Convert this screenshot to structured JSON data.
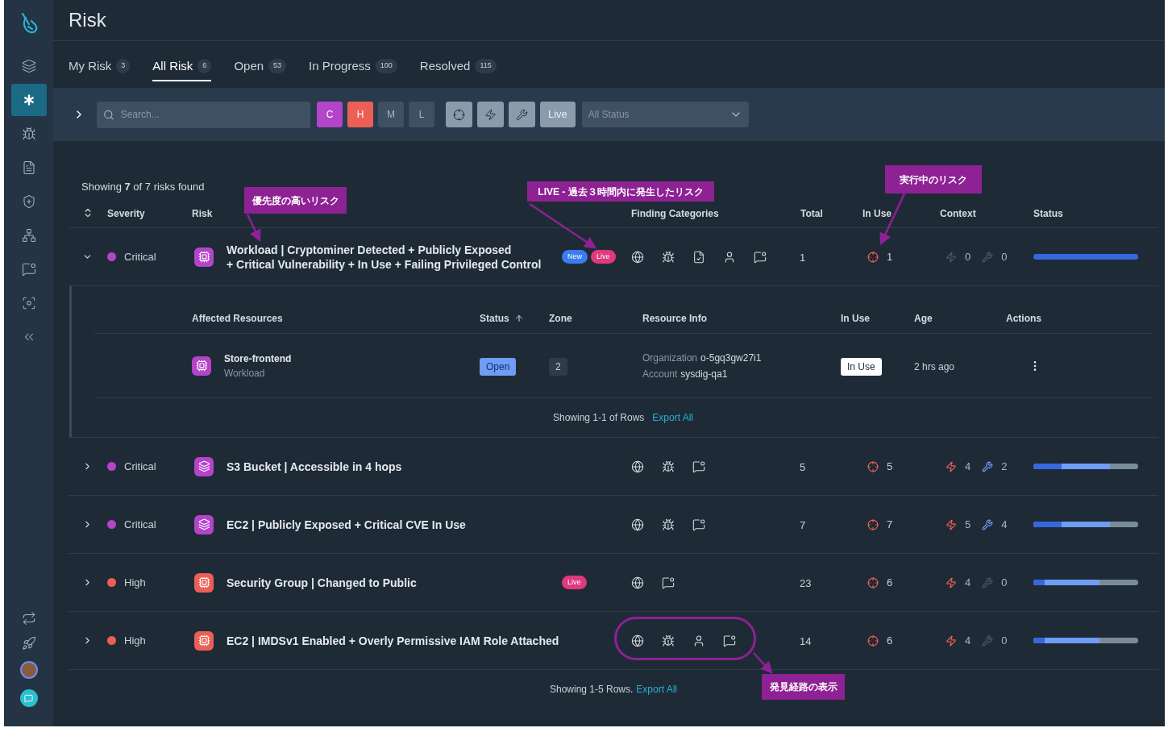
{
  "sidebar": {
    "items": [
      {
        "kind": "layers",
        "selected": false
      },
      {
        "kind": "asterisk",
        "selected": true
      },
      {
        "kind": "bug",
        "selected": false
      },
      {
        "kind": "report",
        "selected": false
      },
      {
        "kind": "shield",
        "selected": false
      },
      {
        "kind": "network",
        "selected": false
      },
      {
        "kind": "message",
        "selected": false
      },
      {
        "kind": "scan",
        "selected": false
      },
      {
        "kind": "collapse",
        "selected": false
      }
    ],
    "bottom_items": [
      {
        "kind": "repeat"
      },
      {
        "kind": "rocket"
      },
      {
        "kind": "avatar"
      },
      {
        "kind": "chat"
      }
    ]
  },
  "page_title": "Risk",
  "tabs": [
    {
      "label": "My Risk",
      "count": "3",
      "selected": false
    },
    {
      "label": "All Risk",
      "count": "6",
      "selected": true
    },
    {
      "label": "Open",
      "count": "53",
      "selected": false
    },
    {
      "label": "In Progress",
      "count": "100",
      "selected": false
    },
    {
      "label": "Resolved",
      "count": "115",
      "selected": false
    }
  ],
  "filters": {
    "search_placeholder": "Search...",
    "severity": [
      {
        "label": "C",
        "color": "#b444c9",
        "selected": true
      },
      {
        "label": "H",
        "color": "#ec5f55",
        "selected": true
      },
      {
        "label": "M",
        "selected": false
      },
      {
        "label": "L",
        "selected": false
      }
    ],
    "toggles": [
      {
        "kind": "in-use"
      },
      {
        "kind": "exploit"
      },
      {
        "kind": "fix"
      },
      {
        "kind": "live",
        "label": "Live"
      }
    ],
    "status_select": {
      "placeholder": "All Status"
    }
  },
  "summary": "Showing **7** of 7 risks found",
  "table": {
    "columns": [
      "Severity",
      "Risk",
      "Finding Categories",
      "Total",
      "In Use",
      "Context",
      "Status"
    ],
    "rows": [
      {
        "expanded": true,
        "severity": "Critical",
        "color": "#b444c9",
        "kind": "workload",
        "risk": "Workload | Cryptominer Detected + Publicly Exposed\n+ Critical Vulnerability + In Use + Failing Privileged Control",
        "badges": [
          {
            "kind": "new",
            "label": "New"
          },
          {
            "kind": "live",
            "label": "Live"
          }
        ],
        "categories": [
          {
            "kind": "network"
          },
          {
            "kind": "vulnerability"
          },
          {
            "kind": "compliance"
          },
          {
            "kind": "identity"
          },
          {
            "kind": "posture"
          }
        ],
        "total": "1",
        "in_use": "1",
        "context": [
          {
            "kind": "exploit",
            "count": "0",
            "active": false
          },
          {
            "kind": "fix",
            "count": "0",
            "active": false
          }
        ],
        "status": [
          {
            "color": "#3567de",
            "level": 1
          }
        ],
        "detail": {
          "columns": [
            {
              "label": "Affected Resources",
              "sorted": false
            },
            {
              "label": "Status",
              "sorted": true
            },
            {
              "label": "Zone",
              "sorted": false
            },
            {
              "label": "Resource Info",
              "sorted": false
            },
            {
              "label": "In Use",
              "sorted": false
            },
            {
              "label": "Age",
              "sorted": false
            },
            {
              "label": "Actions",
              "sorted": false
            }
          ],
          "rows": [
            {
              "name": "Store-frontend",
              "type": "Workload",
              "status": "Open",
              "zone": "2",
              "info": [
                {
                  "label": "Organization",
                  "value": "o-5gq3gw27i1"
                },
                {
                  "label": "Account",
                  "value": "sysdig-qa1"
                }
              ],
              "in_use": "In Use",
              "age": "2 hrs ago"
            }
          ],
          "footer_text": "Showing 1-1 of Rows",
          "footer_link": "Export All"
        }
      },
      {
        "expanded": false,
        "severity": "Critical",
        "color": "#b444c9",
        "kind": "storage",
        "risk": "S3 Bucket | Accessible in 4 hops",
        "badges": [],
        "categories": [
          {
            "kind": "network"
          },
          {
            "kind": "vulnerability"
          },
          {
            "kind": "posture"
          }
        ],
        "total": "5",
        "in_use": "5",
        "context": [
          {
            "kind": "exploit",
            "count": "4",
            "active": true
          },
          {
            "kind": "fix",
            "count": "2",
            "active": true
          }
        ],
        "status": [
          {
            "color": "#3567de",
            "level": 0.27
          },
          {
            "color": "#6f9cf5",
            "level": 0.73
          },
          {
            "color": "#7a8c99",
            "level": 1
          }
        ]
      },
      {
        "expanded": false,
        "severity": "Critical",
        "color": "#b444c9",
        "kind": "storage",
        "risk": "EC2 | Publicly Exposed + Critical CVE In Use",
        "badges": [],
        "categories": [
          {
            "kind": "network"
          },
          {
            "kind": "vulnerability"
          },
          {
            "kind": "posture"
          }
        ],
        "total": "7",
        "in_use": "7",
        "context": [
          {
            "kind": "exploit",
            "count": "5",
            "active": true
          },
          {
            "kind": "fix",
            "count": "4",
            "active": true
          }
        ],
        "status": [
          {
            "color": "#3567de",
            "level": 0.27
          },
          {
            "color": "#6f9cf5",
            "level": 0.73
          },
          {
            "color": "#7a8c99",
            "level": 1
          }
        ]
      },
      {
        "expanded": false,
        "severity": "High",
        "color": "#ec5f55",
        "kind": "workload",
        "risk": "Security Group | Changed to Public",
        "badges": [
          {
            "kind": "live",
            "label": "Live"
          }
        ],
        "categories": [
          {
            "kind": "network"
          },
          {
            "kind": "posture"
          }
        ],
        "total": "23",
        "in_use": "6",
        "context": [
          {
            "kind": "exploit",
            "count": "4",
            "active": true
          },
          {
            "kind": "fix",
            "count": "0",
            "active": false
          }
        ],
        "status": [
          {
            "color": "#3567de",
            "level": 0.11
          },
          {
            "color": "#6f9cf5",
            "level": 0.63
          },
          {
            "color": "#7a8c99",
            "level": 1
          }
        ]
      },
      {
        "expanded": false,
        "severity": "High",
        "color": "#ec5f55",
        "kind": "workload",
        "risk": "EC2 | IMDSv1 Enabled + Overly Permissive IAM Role Attached",
        "badges": [],
        "categories": [
          {
            "kind": "network"
          },
          {
            "kind": "vulnerability"
          },
          {
            "kind": "identity"
          },
          {
            "kind": "posture"
          }
        ],
        "total": "14",
        "in_use": "6",
        "context": [
          {
            "kind": "exploit",
            "count": "4",
            "active": true
          },
          {
            "kind": "fix",
            "count": "0",
            "active": false
          }
        ],
        "status": [
          {
            "color": "#3567de",
            "level": 0.11
          },
          {
            "color": "#6f9cf5",
            "level": 0.63
          },
          {
            "color": "#7a8c99",
            "level": 1
          }
        ]
      }
    ],
    "footer_text": "Showing 1-5 Rows.",
    "footer_link": "Export All"
  },
  "annotations": [
    {
      "text": "優先度の高いリスク"
    },
    {
      "text": "LIVE - 過去３時間内に発生したリスク"
    },
    {
      "text": "実行中のリスク"
    },
    {
      "text": "発見経路の表示"
    }
  ]
}
